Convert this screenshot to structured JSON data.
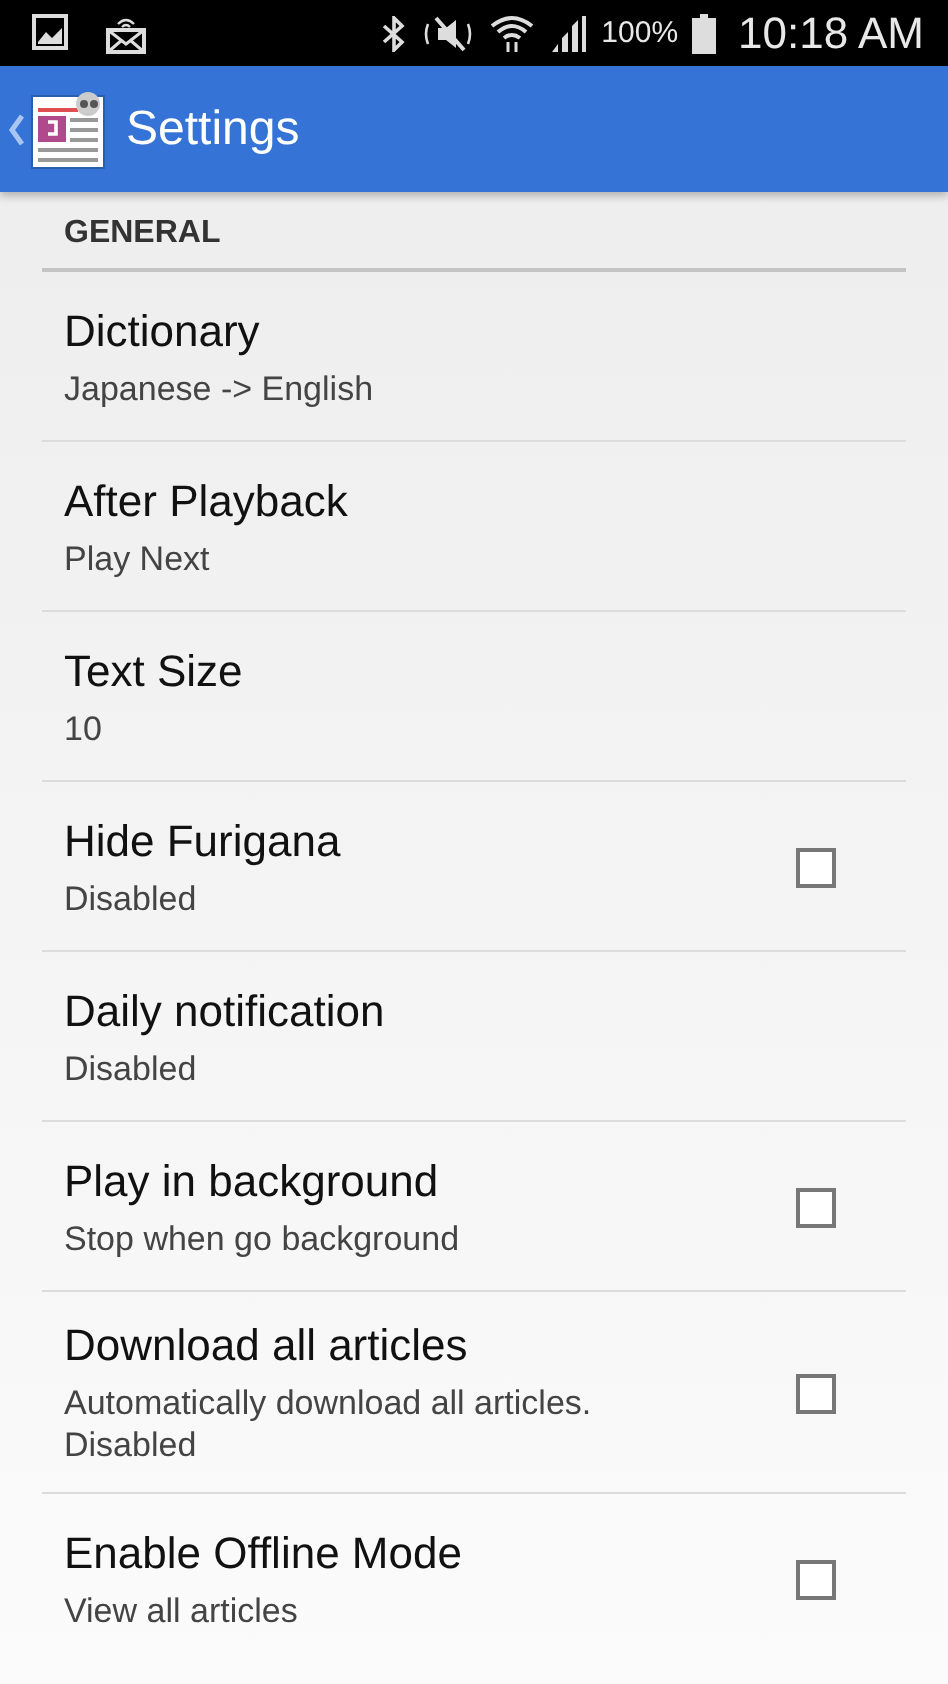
{
  "status_bar": {
    "battery": "100%",
    "time": "10:18 AM"
  },
  "app_bar": {
    "title": "Settings"
  },
  "section": {
    "title": "GENERAL"
  },
  "items": [
    {
      "kind": "list",
      "title": "Dictionary",
      "summary": "Japanese -> English"
    },
    {
      "kind": "list",
      "title": "After Playback",
      "summary": "Play Next"
    },
    {
      "kind": "list",
      "title": "Text Size",
      "summary": "10"
    },
    {
      "kind": "checkbox",
      "title": "Hide Furigana",
      "summary": "Disabled",
      "checked": false
    },
    {
      "kind": "list",
      "title": "Daily notification",
      "summary": "Disabled"
    },
    {
      "kind": "checkbox",
      "title": "Play in background",
      "summary": "Stop when go background",
      "checked": false
    },
    {
      "kind": "checkbox",
      "title": "Download all articles",
      "summary": "Automatically download all articles.\nDisabled",
      "checked": false
    },
    {
      "kind": "checkbox",
      "title": "Enable Offline Mode",
      "summary": "View all articles",
      "checked": false
    }
  ]
}
